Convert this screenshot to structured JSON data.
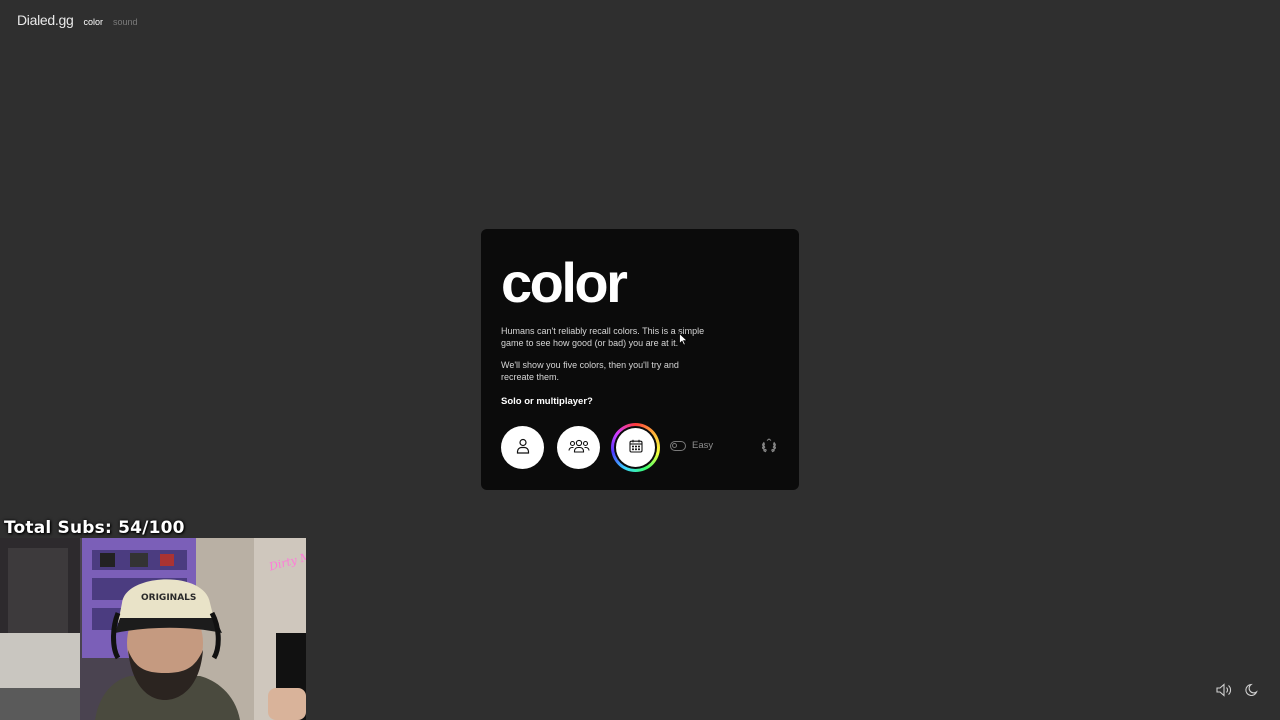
{
  "nav": {
    "brand": "Dialed.gg",
    "links": [
      {
        "label": "color",
        "active": true
      },
      {
        "label": "sound",
        "active": false
      }
    ]
  },
  "card": {
    "title": "color",
    "description": [
      "Humans can't reliably recall colors. This is a simple game to see how good (or bad) you are at it.",
      "We'll show you five colors, then you'll try and recreate them."
    ],
    "question": "Solo or multiplayer?",
    "buttons": {
      "solo_icon": "person-icon",
      "multiplayer_icon": "group-icon",
      "daily_icon": "calendar-icon"
    },
    "difficulty_label": "Easy",
    "difficulty_toggle_on": false,
    "leaderboard_icon": "laurel-icon"
  },
  "corner": {
    "sound_icon": "speaker-icon",
    "theme_icon": "moon-icon"
  },
  "overlay": {
    "subs_text": "Total Subs: 54/100",
    "webcam_sign": "Dirty Mahad",
    "cap_text": "ORIGINALS"
  },
  "colors": {
    "background": "#2f2f2f",
    "card": "#0b0b0b",
    "button": "#ffffff"
  }
}
